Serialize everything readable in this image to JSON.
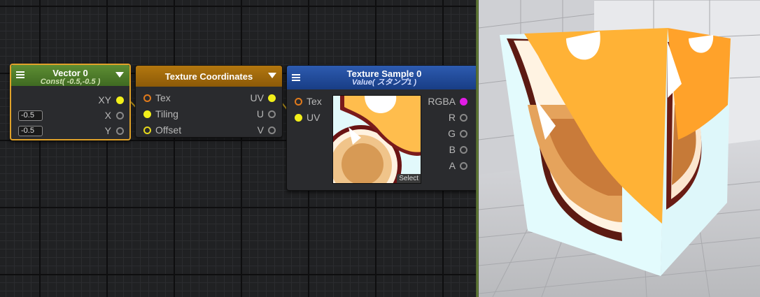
{
  "nodes": {
    "vector": {
      "title": "Vector 0",
      "subtitle": "Const( -0.5,-0.5 )",
      "outputs": [
        "XY",
        "X",
        "Y"
      ],
      "x_value": "-0.5",
      "y_value": "-0.5",
      "header_color": "#4e7a2c",
      "selected_border": "#e0a22a"
    },
    "texcoords": {
      "title": "Texture Coordinates",
      "inputs": [
        "Tex",
        "Tiling",
        "Offset"
      ],
      "outputs": [
        "UV",
        "U",
        "V"
      ],
      "header_color": "#a4690d"
    },
    "texsample": {
      "title": "Texture Sample 0",
      "subtitle": "Value( スタンプ1 )",
      "inputs": [
        "Tex",
        "UV"
      ],
      "outputs": [
        "RGBA",
        "R",
        "G",
        "B",
        "A"
      ],
      "select_label": "Select",
      "header_color": "#1f4a9a"
    }
  },
  "colors": {
    "port_yellow": "#f2ef1a",
    "port_orange": "#e07a1c",
    "port_magenta": "#e21ce6",
    "wire": "#c9a21d"
  }
}
